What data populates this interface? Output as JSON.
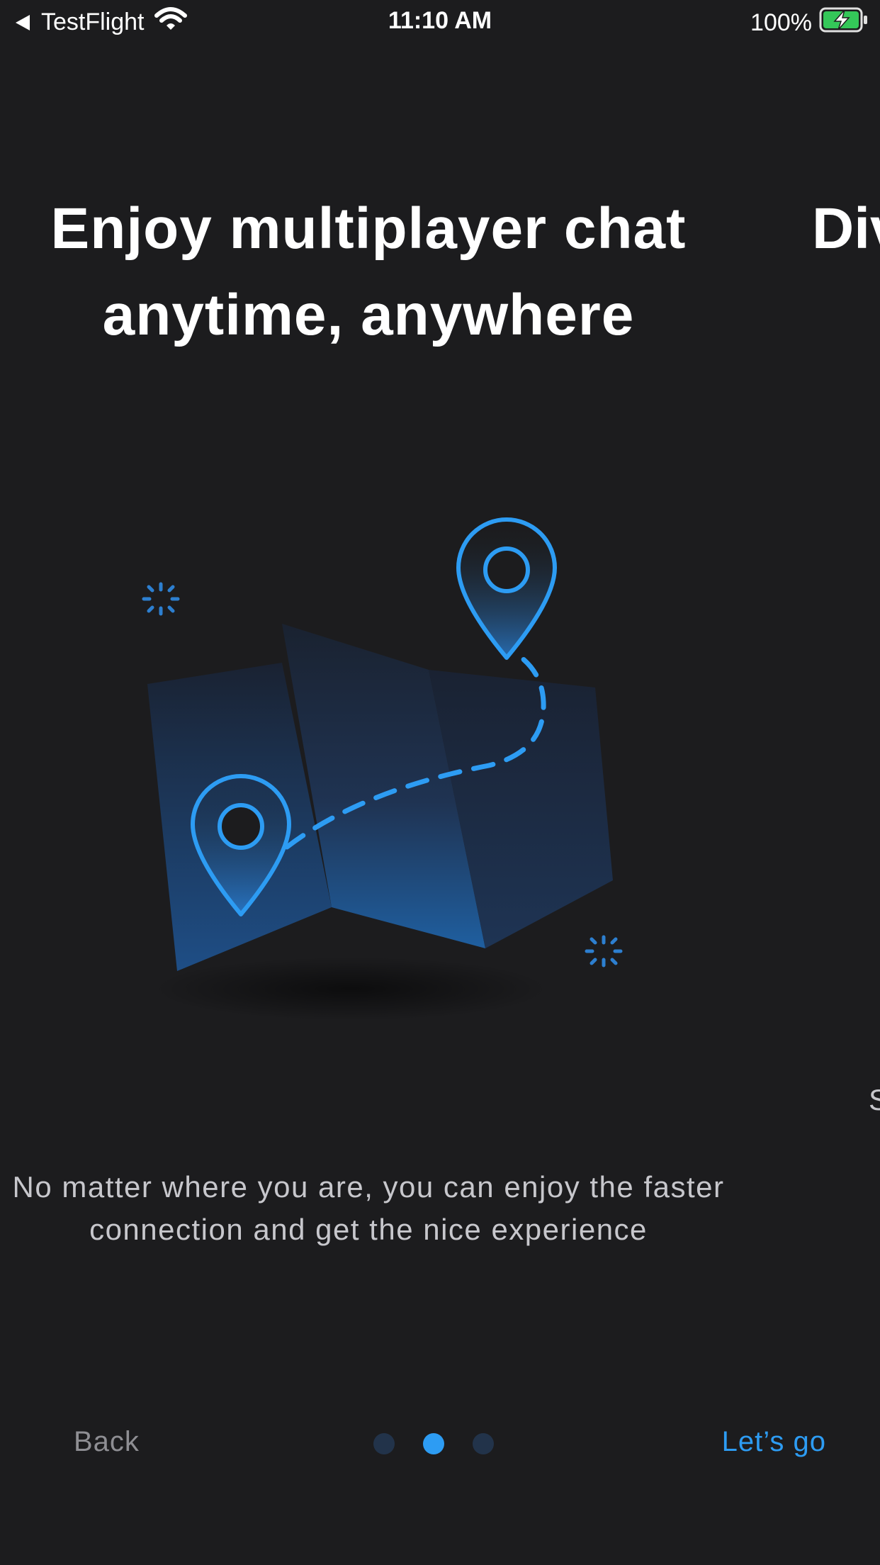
{
  "status_bar": {
    "back_app": "TestFlight",
    "time": "11:10 AM",
    "battery": "100%"
  },
  "slide": {
    "title_line1": "Enjoy multiplayer chat",
    "title_line2": "anytime, anywhere",
    "description_line1": "No matter where you are, you can enjoy the faster",
    "description_line2": "connection and get the nice experience"
  },
  "next_slide_peek": {
    "title": "Div",
    "description": "S"
  },
  "navigation": {
    "back_label": "Back",
    "next_label": "Let’s go",
    "pages": 3,
    "active_page": 2
  },
  "colors": {
    "background": "#1c1c1e",
    "accent": "#2d9cf3",
    "dot_inactive": "#22334a"
  }
}
